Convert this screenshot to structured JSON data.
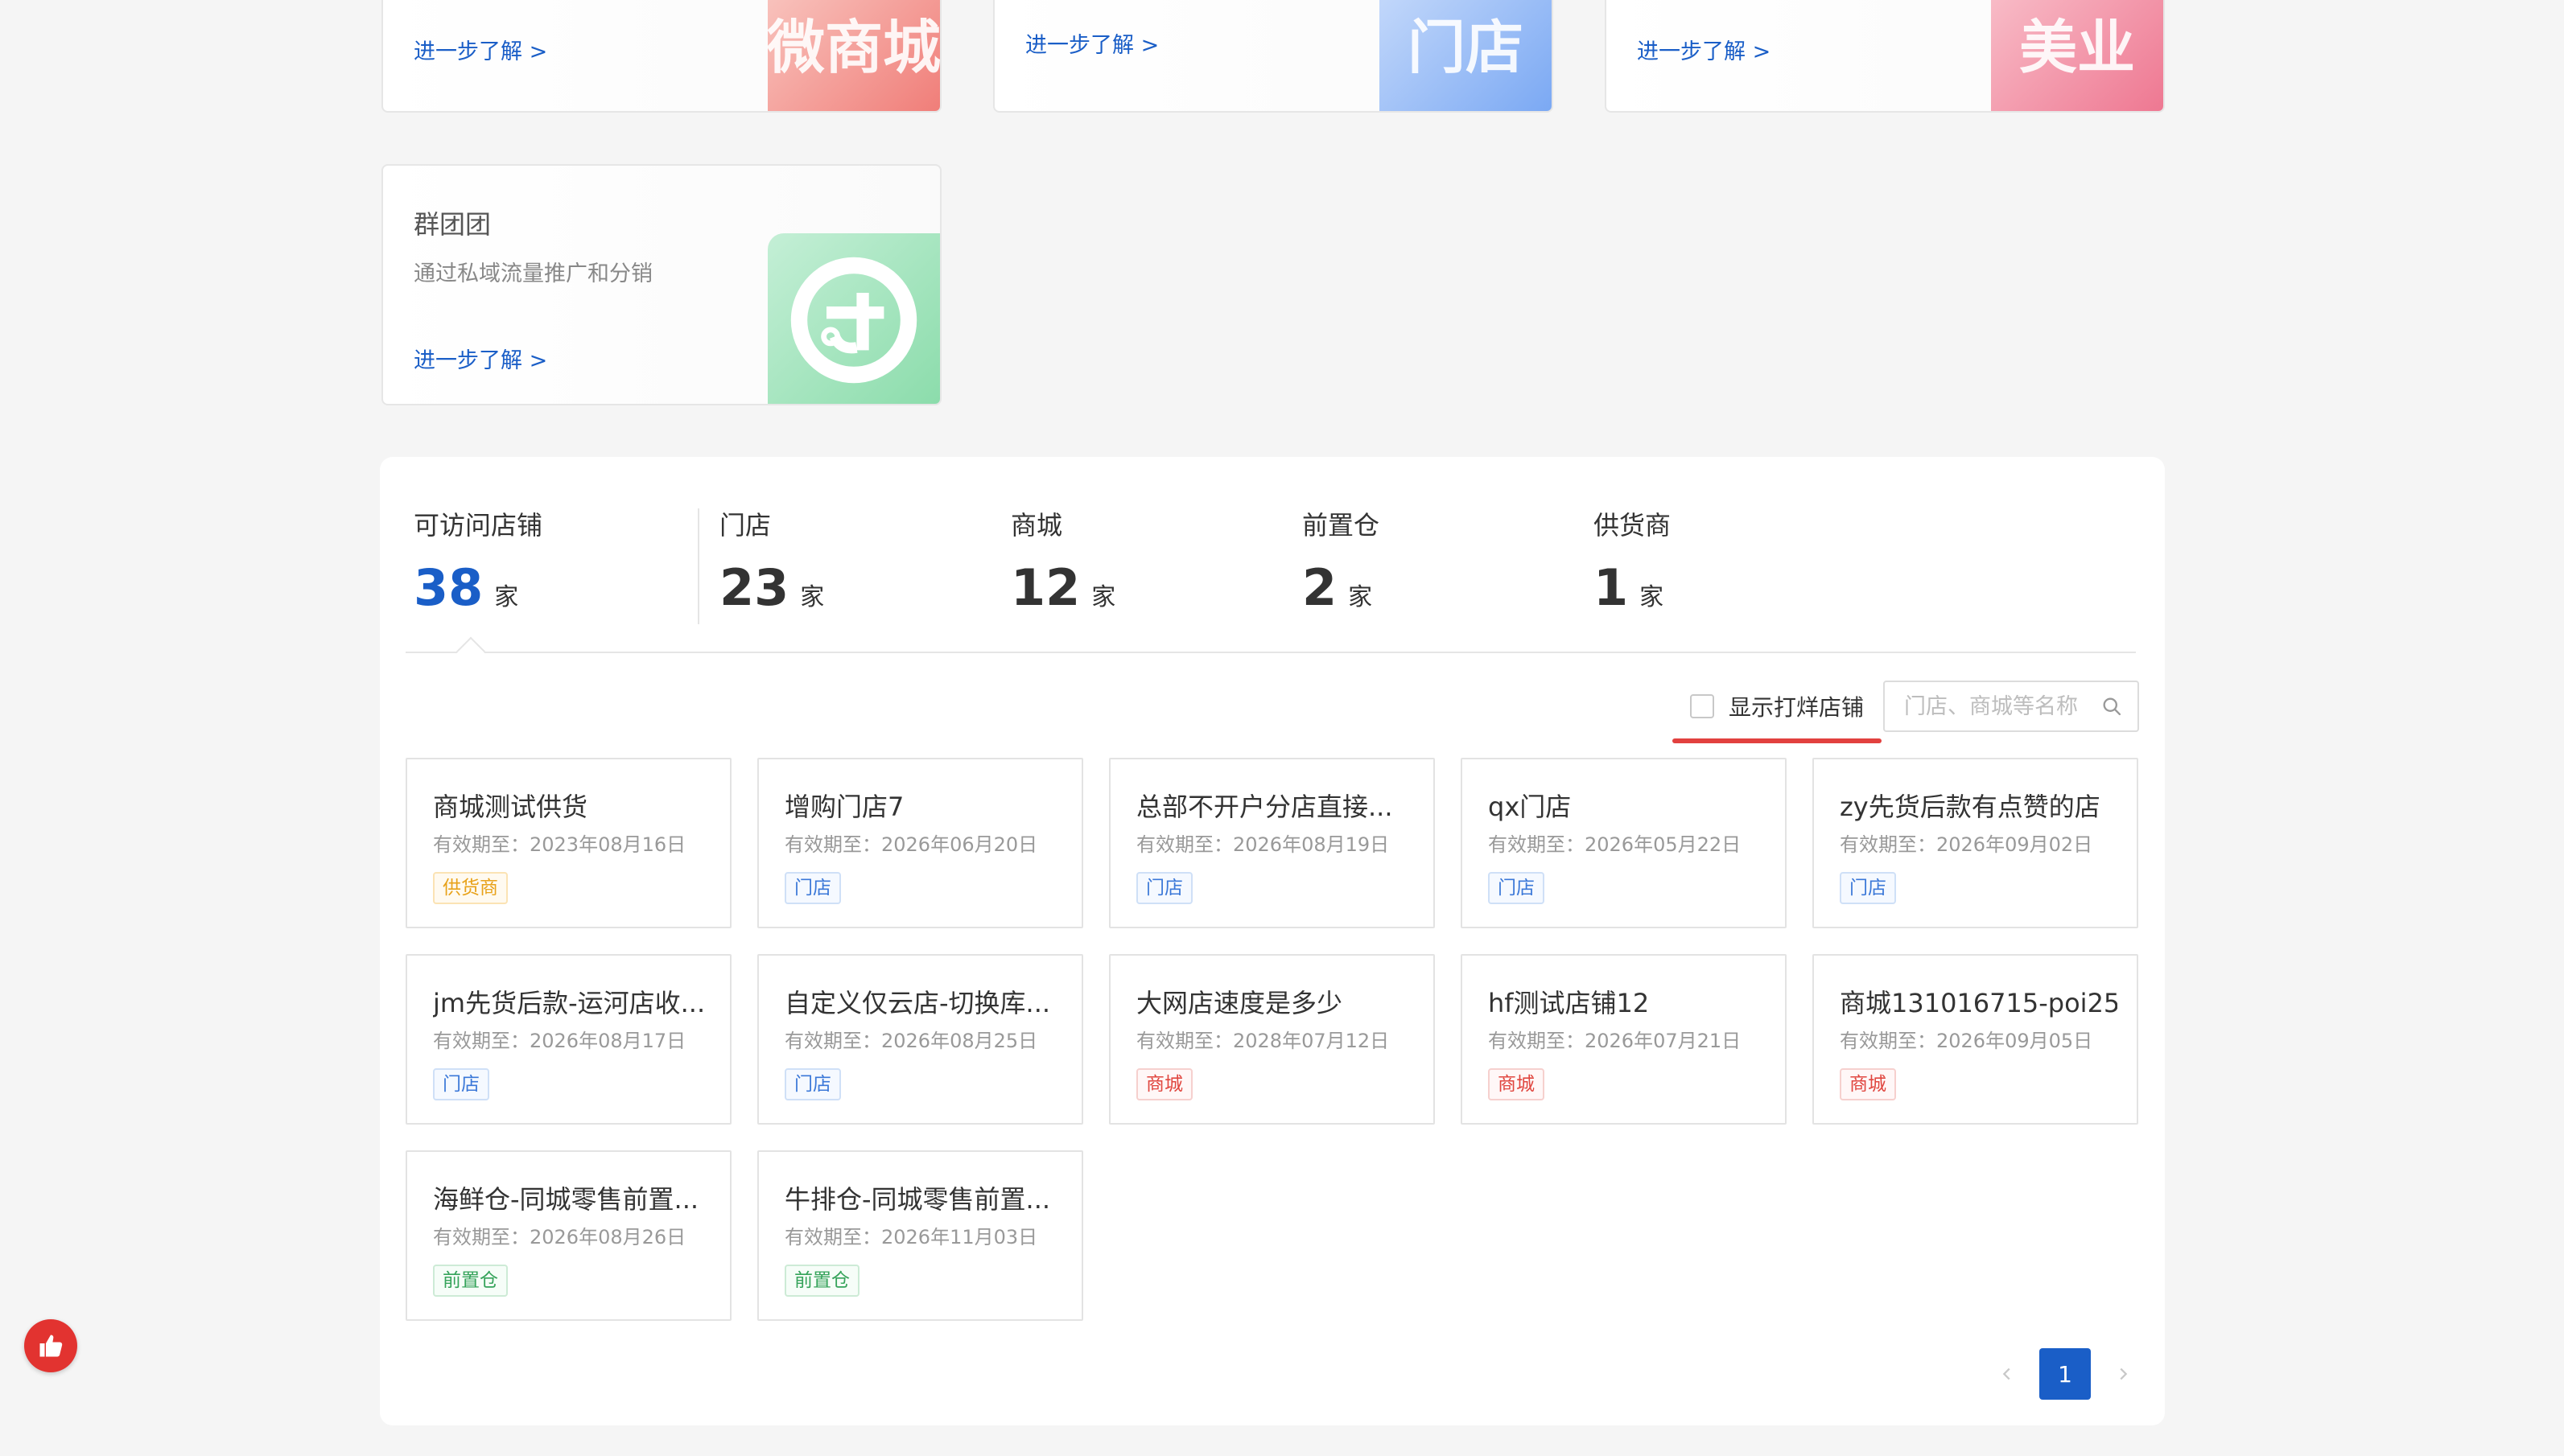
{
  "products": [
    {
      "title": "",
      "desc": "",
      "link": "进一步了解 >",
      "art": "微商城",
      "accent": "#f45b5b"
    },
    {
      "title": "",
      "desc": "",
      "link": "进一步了解 >",
      "art": "门店",
      "accent": "#5b8df2"
    },
    {
      "title": "",
      "desc": "",
      "link": "进一步了解 >",
      "art": "美业",
      "accent": "#ef5f7d"
    },
    {
      "title": "群团团",
      "desc": "通过私域流量推广和分销",
      "link": "进一步了解 >",
      "art": "团",
      "accent": "#3cc07a"
    }
  ],
  "stats": [
    {
      "label": "可访问店铺",
      "value": "38",
      "unit": "家"
    },
    {
      "label": "门店",
      "value": "23",
      "unit": "家"
    },
    {
      "label": "商城",
      "value": "12",
      "unit": "家"
    },
    {
      "label": "前置仓",
      "value": "2",
      "unit": "家"
    },
    {
      "label": "供货商",
      "value": "1",
      "unit": "家"
    }
  ],
  "filter": {
    "checkbox_label": "显示打烊店铺",
    "checked": false,
    "search_placeholder": "门店、商城等名称"
  },
  "tag_colors": {
    "供货商": {
      "color": "#e8a21a",
      "border": "#fbe3b4",
      "bg": "#fffaf0"
    },
    "门店": {
      "color": "#3b78d8",
      "border": "#cfe0f7",
      "bg": "#f5f9ff"
    },
    "商城": {
      "color": "#e0463f",
      "border": "#f6d0ce",
      "bg": "#fff7f7"
    },
    "前置仓": {
      "color": "#35a35a",
      "border": "#cdebd6",
      "bg": "#f6fdf8"
    }
  },
  "stores": [
    {
      "name": "商城测试供货",
      "date": "有效期至：2023年08月16日",
      "tag": "供货商"
    },
    {
      "name": "增购门店7",
      "date": "有效期至：2026年06月20日",
      "tag": "门店"
    },
    {
      "name": "总部不开户分店直接...",
      "date": "有效期至：2026年08月19日",
      "tag": "门店"
    },
    {
      "name": "qx门店",
      "date": "有效期至：2026年05月22日",
      "tag": "门店"
    },
    {
      "name": "zy先货后款有点赞的店",
      "date": "有效期至：2026年09月02日",
      "tag": "门店"
    },
    {
      "name": "jm先货后款-运河店收...",
      "date": "有效期至：2026年08月17日",
      "tag": "门店"
    },
    {
      "name": "自定义仅云店-切换库...",
      "date": "有效期至：2026年08月25日",
      "tag": "门店"
    },
    {
      "name": "大网店速度是多少",
      "date": "有效期至：2028年07月12日",
      "tag": "商城"
    },
    {
      "name": "hf测试店铺12",
      "date": "有效期至：2026年07月21日",
      "tag": "商城"
    },
    {
      "name": "商城131016715-poi25...",
      "date": "有效期至：2026年09月05日",
      "tag": "商城"
    },
    {
      "name": "海鲜仓-同城零售前置...",
      "date": "有效期至：2026年08月26日",
      "tag": "前置仓"
    },
    {
      "name": "牛排仓-同城零售前置...",
      "date": "有效期至：2026年11月03日",
      "tag": "前置仓"
    }
  ],
  "pagination": {
    "current": "1"
  },
  "icons": {
    "search": "search-icon",
    "like": "thumbs-up-icon",
    "prev": "chevron-left-icon",
    "next": "chevron-right-icon"
  }
}
